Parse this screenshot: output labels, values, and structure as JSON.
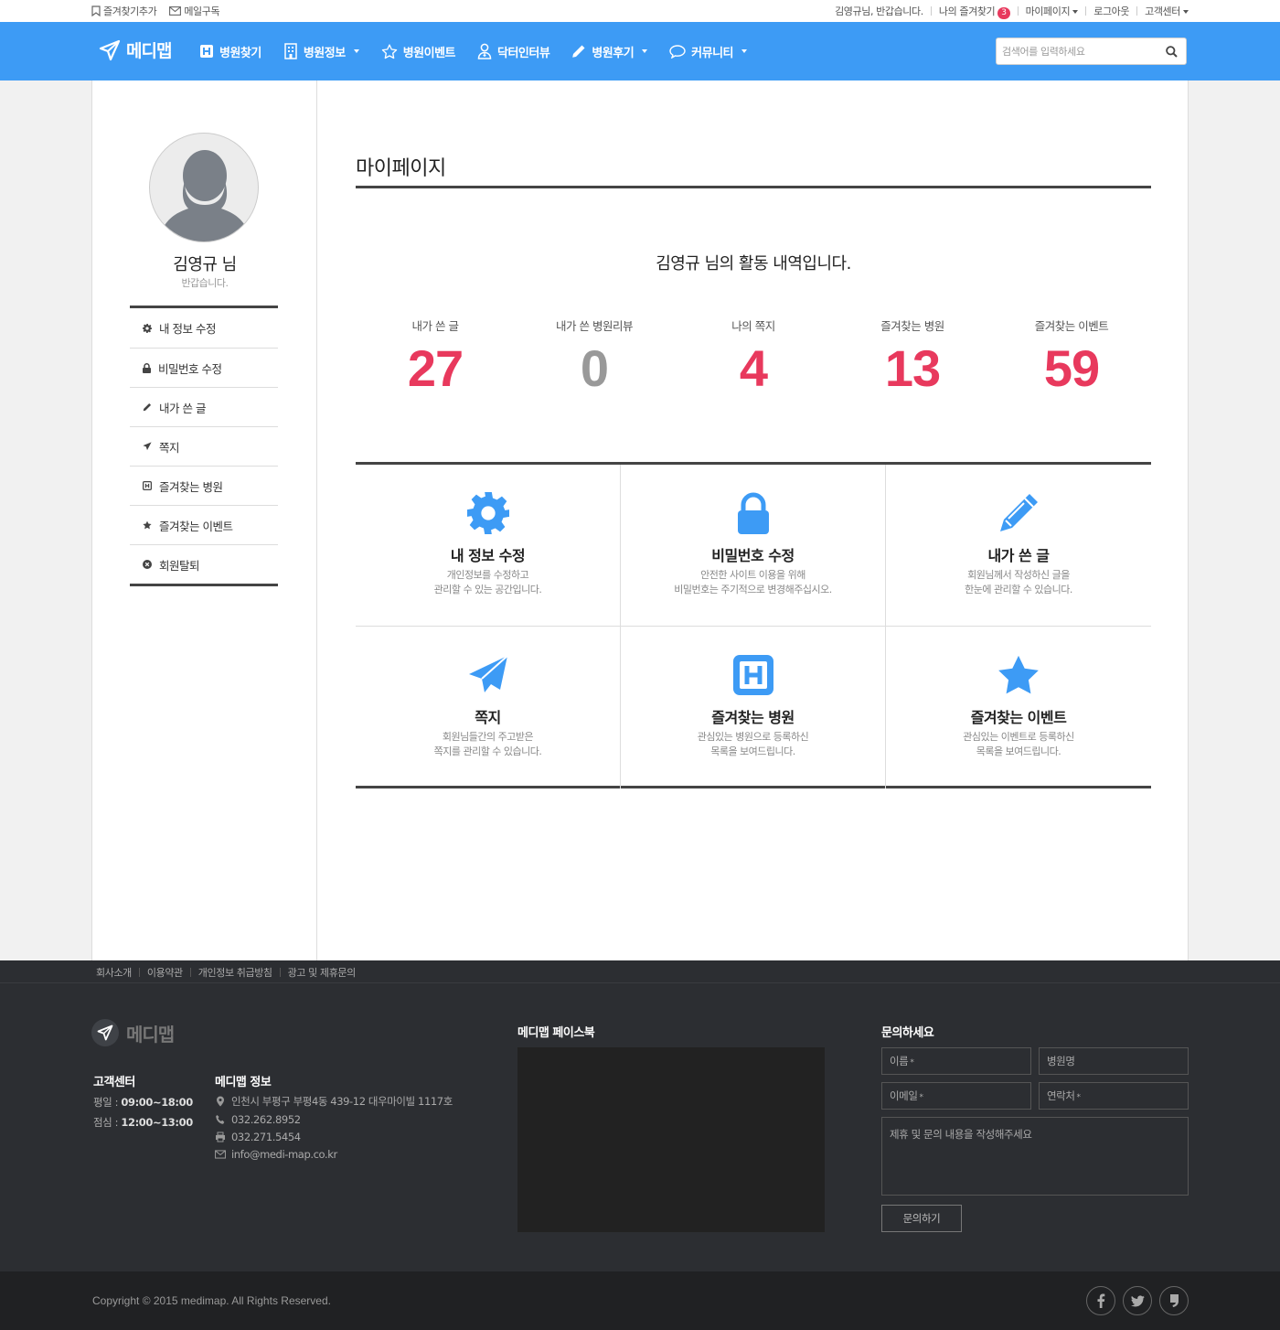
{
  "topbar": {
    "bookmark_add": "즐겨찾기추가",
    "mail_subscribe": "메일구독",
    "greeting": "김영규님, 반갑습니다.",
    "my_favorites": "나의 즐겨찾기",
    "favorites_count": "3",
    "mypage": "마이페이지",
    "logout": "로그아웃",
    "customer_center": "고객센터"
  },
  "nav": {
    "brand": "메디맵",
    "items": [
      {
        "label": "병원찾기",
        "icon": "hospital-icon"
      },
      {
        "label": "병원정보",
        "icon": "building-icon"
      },
      {
        "label": "병원이벤트",
        "icon": "star-icon"
      },
      {
        "label": "닥터인터뷰",
        "icon": "doctor-icon"
      },
      {
        "label": "병원후기",
        "icon": "pencil-icon"
      },
      {
        "label": "커뮤니티",
        "icon": "chat-bubble-icon"
      }
    ],
    "search_placeholder": "검색어를 입력하세요"
  },
  "sidebar": {
    "name": "김영규 님",
    "welcome": "반갑습니다.",
    "items": [
      {
        "label": "내 정보 수정",
        "icon": "gear-icon"
      },
      {
        "label": "비밀번호 수정",
        "icon": "lock-icon"
      },
      {
        "label": "내가 쓴 글",
        "icon": "pencil-icon"
      },
      {
        "label": "쪽지",
        "icon": "paper-plane-icon"
      },
      {
        "label": "즐겨찾는 병원",
        "icon": "hospital-icon"
      },
      {
        "label": "즐겨찾는 이벤트",
        "icon": "star-icon"
      },
      {
        "label": "회원탈퇴",
        "icon": "close-circle-icon"
      }
    ]
  },
  "main": {
    "title": "마이페이지",
    "activity_title": "김영규 님의 활동 내역입니다.",
    "stats": [
      {
        "label": "내가 쓴 글",
        "value": "27"
      },
      {
        "label": "내가 쓴 병원리뷰",
        "value": "0"
      },
      {
        "label": "나의 쪽지",
        "value": "4"
      },
      {
        "label": "즐겨찾는 병원",
        "value": "13"
      },
      {
        "label": "즐겨찾는 이벤트",
        "value": "59"
      }
    ],
    "cards": [
      {
        "title": "내 정보 수정",
        "line1": "개인정보를 수정하고",
        "line2": "관리할 수 있는 공간입니다.",
        "icon": "gear-icon"
      },
      {
        "title": "비밀번호 수정",
        "line1": "안전한 사이트 이용을 위해",
        "line2": "비밀번호는 주기적으로 변경해주십시오.",
        "icon": "lock-icon"
      },
      {
        "title": "내가 쓴 글",
        "line1": "회원님께서 작성하신 글을",
        "line2": "한눈에 관리할 수 있습니다.",
        "icon": "pencil-icon"
      },
      {
        "title": "쪽지",
        "line1": "회원님들간의 주고받은",
        "line2": "쪽지를 관리할 수 있습니다.",
        "icon": "paper-plane-icon"
      },
      {
        "title": "즐겨찾는 병원",
        "line1": "관심있는 병원으로 등록하신",
        "line2": "목록을 보여드립니다.",
        "icon": "hospital-icon"
      },
      {
        "title": "즐겨찾는 이벤트",
        "line1": "관심있는 이벤트로 등록하신",
        "line2": "목록을 보여드립니다.",
        "icon": "star-icon"
      }
    ]
  },
  "footer": {
    "links": [
      "회사소개",
      "이용약관",
      "개인정보 취급방침",
      "광고 및 제휴문의"
    ],
    "brand": "메디맵",
    "cs_title": "고객센터",
    "weekday_label": "평일 :",
    "weekday_hours": "09:00~18:00",
    "lunch_label": "점심 :",
    "lunch_hours": "12:00~13:00",
    "info_title": "메디맵 정보",
    "address": "인천시 부평구 부평4동 439-12 대우마이빌 1117호",
    "phone": "032.262.8952",
    "fax": "032.271.5454",
    "email": "info@medi-map.co.kr",
    "facebook_title": "메디맵 페이스북",
    "contact_title": "문의하세요",
    "name_field": "이름",
    "hospital_field": "병원명",
    "email_field": "이메일",
    "phone_field": "연락처",
    "required_mark": "*",
    "message_field": "제휴 및 문의 내용을 작성해주세요",
    "submit": "문의하기",
    "copyright": "Copyright © 2015 medimap. All Rights Reserved."
  },
  "colors": {
    "brand_blue": "#3d9bf5",
    "accent_red": "#e8395d",
    "footer_bg": "#2c2e32"
  }
}
